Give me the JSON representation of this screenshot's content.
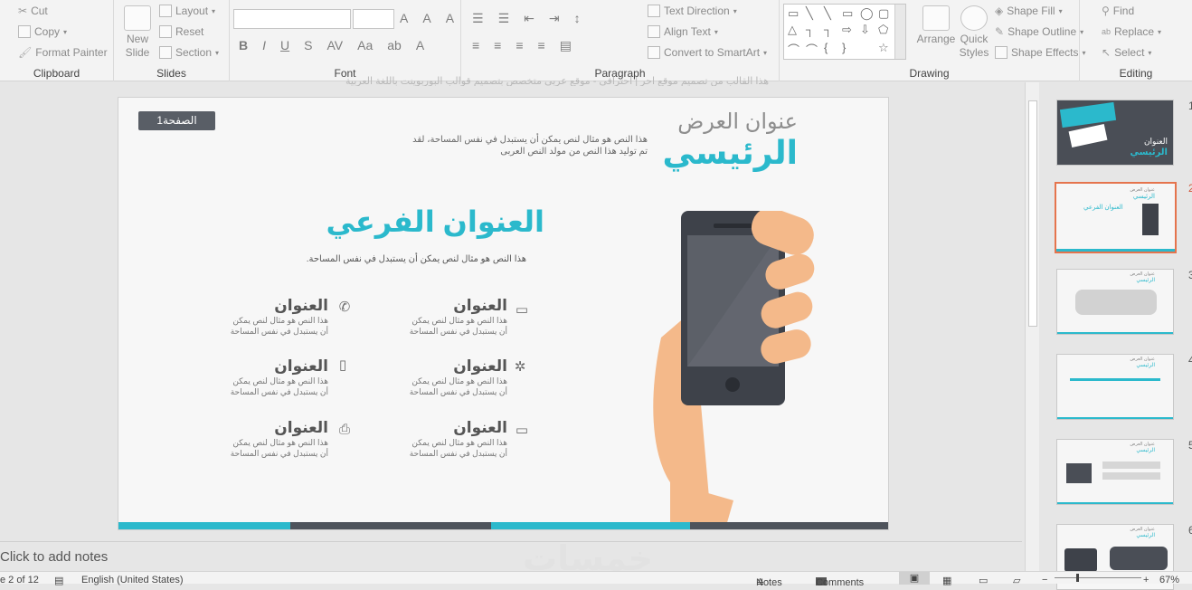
{
  "ribbon": {
    "clipboard": {
      "label": "Clipboard",
      "cut": "Cut",
      "copy": "Copy",
      "format_painter": "Format Painter"
    },
    "slides": {
      "label": "Slides",
      "new_slide": "New Slide",
      "layout": "Layout",
      "reset": "Reset",
      "section": "Section"
    },
    "font": {
      "label": "Font"
    },
    "paragraph": {
      "label": "Paragraph",
      "text_direction": "Text Direction",
      "align_text": "Align Text",
      "convert_smartart": "Convert to SmartArt"
    },
    "drawing": {
      "label": "Drawing",
      "arrange": "Arrange",
      "quick_styles": "Quick Styles",
      "shape_fill": "Shape Fill",
      "shape_outline": "Shape Outline",
      "shape_effects": "Shape Effects"
    },
    "editing": {
      "label": "Editing",
      "find": "Find",
      "replace": "Replace",
      "select": "Select"
    }
  },
  "header_line": "هذا القالب من تصميم موقع احر | احترافي - موقع عربي متخصص بتصميم قوالب البوربوينت باللغة العربية",
  "slide": {
    "page_badge": "الصفحة1",
    "title_line1": "عنوان العرض",
    "title_line2": "الرئيسي",
    "intro_text": "هذا النص هو مثال لنص يمكن أن يستبدل في نفس المساحة، لقد تم توليد هذا النص من مولد النص العربى",
    "subtitle": "العنوان الفرعي",
    "subtitle_desc": "هذا النص هو مثال لنص يمكن أن يستبدل في نفس المساحة.",
    "items": [
      {
        "title": "العنوان",
        "line1": "هذا النص هو مثال لنص يمكن",
        "line2": "أن يستبدل في نفس المساحة",
        "icon": "phone-icon"
      },
      {
        "title": "العنوان",
        "line1": "هذا النص هو مثال لنص يمكن",
        "line2": "أن يستبدل في نفس المساحة",
        "icon": "chat-icon"
      },
      {
        "title": "العنوان",
        "line1": "هذا النص هو مثال لنص يمكن",
        "line2": "أن يستبدل في نفس المساحة",
        "icon": "mobile-icon"
      },
      {
        "title": "العنوان",
        "line1": "هذا النص هو مثال لنص يمكن",
        "line2": "أن يستبدل في نفس المساحة",
        "icon": "network-icon"
      },
      {
        "title": "العنوان",
        "line1": "هذا النص هو مثال لنص يمكن",
        "line2": "أن يستبدل في نفس المساحة",
        "icon": "printer-icon"
      },
      {
        "title": "العنوان",
        "line1": "هذا النص هو مثال لنص يمكن",
        "line2": "أن يستبدل في نفس المساحة",
        "icon": "monitor-icon"
      }
    ],
    "colors": {
      "accent": "#2bb9cc",
      "dark": "#4e535b",
      "skin": "#f4b98a"
    }
  },
  "thumbnails": [
    {
      "num": "1",
      "title1": "العنوان",
      "title2": "الرئيسي"
    },
    {
      "num": "2",
      "title1": "عنوان العرض",
      "title2": "الرئيسي",
      "sub": "العنوان الفرعي"
    },
    {
      "num": "3",
      "title1": "عنوان العرض",
      "title2": "الرئيسي"
    },
    {
      "num": "4",
      "title1": "عنوان العرض",
      "title2": "الرئيسي"
    },
    {
      "num": "5",
      "title1": "عنوان العرض",
      "title2": "الرئيسي"
    },
    {
      "num": "6",
      "title1": "عنوان العرض",
      "title2": "الرئيسي"
    }
  ],
  "notes": {
    "placeholder": "Click to add notes",
    "watermark": "خمسات"
  },
  "status": {
    "slide_counter": "e 2 of 12",
    "language": "English (United States)",
    "notes": "Notes",
    "comments": "Comments",
    "zoom": "67%"
  }
}
